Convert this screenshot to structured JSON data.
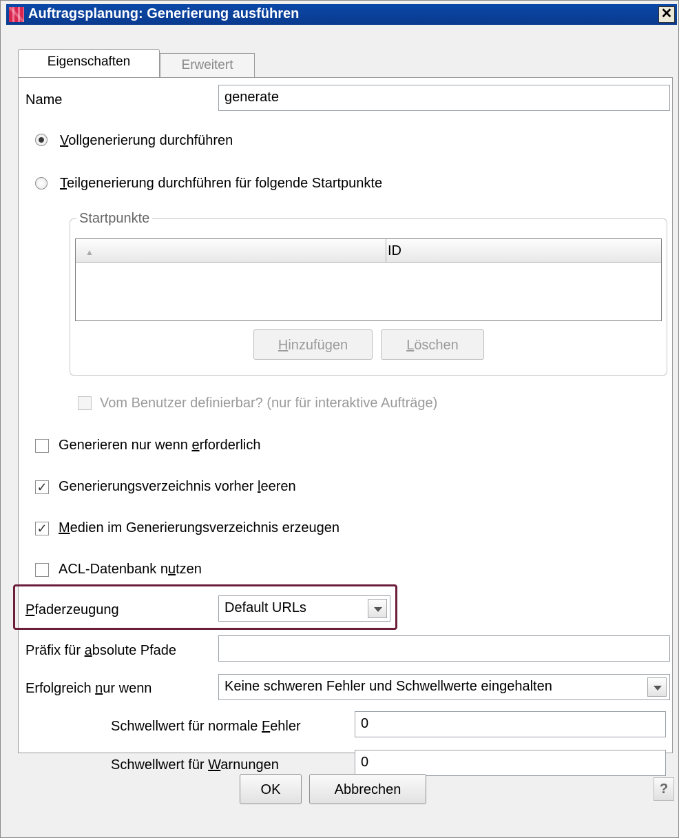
{
  "window": {
    "title": "Auftragsplanung: Generierung ausführen",
    "close_symbol": "✕"
  },
  "tabs": [
    {
      "label": "Eigenschaften",
      "active": true
    },
    {
      "label": "Erweitert",
      "active": false
    }
  ],
  "name_field": {
    "label": "Name",
    "value": "generate"
  },
  "radios": {
    "full": {
      "prefix": "V",
      "rest": "ollgenerierung durchführen",
      "selected": true
    },
    "partial": {
      "prefix": "T",
      "rest": "eilgenerierung durchführen für folgende Startpunkte",
      "selected": false
    }
  },
  "startpoints": {
    "group_title": "Startpunkte",
    "columns": [
      "▲",
      "ID"
    ],
    "rows": [],
    "add_button": {
      "prefix": "H",
      "rest": "inzufügen"
    },
    "delete_button": {
      "prefix": "L",
      "rest": "öschen"
    }
  },
  "user_definable": {
    "label": "Vom Benutzer definierbar? (nur für interaktive Aufträge)",
    "checked": false,
    "enabled": false
  },
  "checkboxes": [
    {
      "pre": "Generieren nur wenn ",
      "u": "e",
      "post": "rforderlich",
      "checked": false
    },
    {
      "pre": "Generierungsverzeichnis vorher ",
      "u": "l",
      "post": "eeren",
      "checked": true
    },
    {
      "pre": "",
      "u": "M",
      "post": "edien im Generierungsverzeichnis erzeugen",
      "checked": true
    },
    {
      "pre": "ACL-Datenbank n",
      "u": "u",
      "post": "tzen",
      "checked": false
    }
  ],
  "path_generation": {
    "label_u": "P",
    "label_rest": "faderzeugung",
    "value": "Default URLs"
  },
  "prefix_abs": {
    "pre": "Präfix für ",
    "u": "a",
    "post": "bsolute Pfade",
    "value": ""
  },
  "success_if": {
    "pre": "Erfolgreich ",
    "u": "n",
    "post": "ur wenn",
    "value": "Keine schweren Fehler und Schwellwerte eingehalten"
  },
  "threshold_errors": {
    "pre": "Schwellwert für normale ",
    "u": "F",
    "post": "ehler",
    "value": "0"
  },
  "threshold_warnings": {
    "pre": "Schwellwert für ",
    "u": "W",
    "post": "arnungen",
    "value": "0"
  },
  "footer": {
    "ok": "OK",
    "cancel": "Abbrechen",
    "help": "?"
  },
  "colors": {
    "titlebar": "#0a48a8",
    "highlight_border": "#6b1d3a"
  }
}
